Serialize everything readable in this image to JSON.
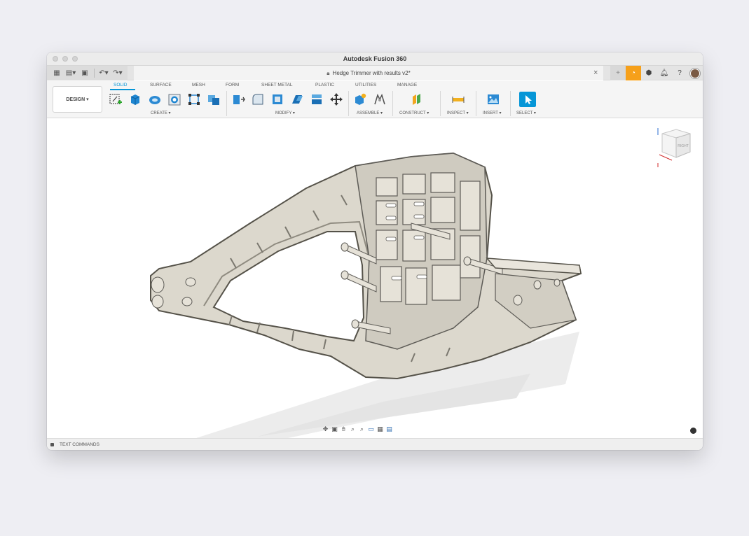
{
  "window": {
    "title": "Autodesk Fusion 360"
  },
  "tabbar": {
    "doc_title": "Hedge Trimmer with results v2*",
    "close_glyph": "×"
  },
  "ribbon": {
    "workspace": "DESIGN ▾",
    "tabs": [
      "SOLID",
      "SURFACE",
      "MESH",
      "FORM",
      "SHEET METAL",
      "PLASTIC",
      "UTILITIES",
      "MANAGE"
    ],
    "active_tab": "SOLID",
    "groups": [
      "CREATE ▾",
      "MODIFY ▾",
      "ASSEMBLE ▾",
      "CONSTRUCT ▾",
      "INSPECT ▾",
      "INSERT ▾",
      "SELECT ▾"
    ]
  },
  "viewcube": {
    "face_label": "RIGHT"
  },
  "status": {
    "text_commands": "TEXT COMMANDS"
  },
  "colors": {
    "accent": "#0696d7",
    "job_status": "#f6a01a",
    "model_fill": "#ddd9cf",
    "model_edge": "#5d5b56"
  }
}
